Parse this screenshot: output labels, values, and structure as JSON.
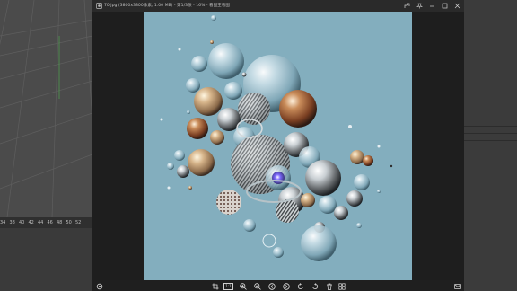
{
  "viewer": {
    "title": "70.jpg (3800x3800像素, 1.00 MB) - 第1/3张 - 16% - 看图王看图",
    "toolbar": {
      "actual_size_label": "1:1"
    }
  },
  "background_app": {
    "ruler_numbers": [
      "34",
      "38",
      "40",
      "42",
      "44",
      "46",
      "48",
      "50",
      "52"
    ]
  },
  "colors": {
    "canvas_background": "#83aebe",
    "viewer_background": "#1e1e1e",
    "titlebar": "#2a2a2a",
    "accent_icon": "#e0e0e0"
  },
  "icons": [
    "image-file-icon",
    "share-icon",
    "minimize-icon",
    "maximize-icon",
    "close-icon",
    "crop-icon",
    "zoom-in-icon",
    "zoom-out-icon",
    "previous-icon",
    "next-icon",
    "rotate-left-icon",
    "rotate-right-icon",
    "delete-icon",
    "grid-icon",
    "settings-icon",
    "mail-icon"
  ]
}
